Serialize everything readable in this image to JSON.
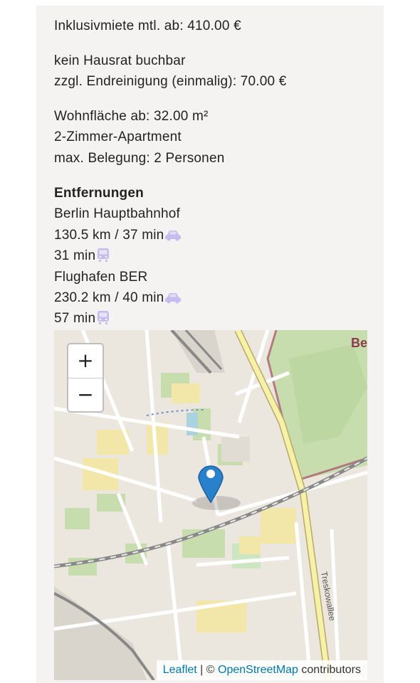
{
  "details": {
    "rent": "Inklusivmiete mtl. ab: 410.00 €",
    "household": "kein Hausrat buchbar",
    "cleaning": "zzgl. Endreinigung (einmalig): 70.00 €",
    "area": "Wohnfläche ab: 32.00 m²",
    "type": "2-Zimmer-Apartment",
    "occupancy": "max. Belegung: 2 Personen"
  },
  "distances": {
    "heading": "Entfernungen",
    "items": [
      {
        "place": "Berlin Hauptbahnhof",
        "car": "130.5 km / 37 min",
        "transit": "31 min"
      },
      {
        "place": "Flughafen BER",
        "car": "230.2 km / 40 min",
        "transit": "57 min"
      }
    ]
  },
  "map": {
    "zoom_in": "+",
    "zoom_out": "−",
    "attribution_leaflet": "Leaflet",
    "attribution_sep": " | © ",
    "attribution_osm": "OpenStreetMap",
    "attribution_tail": " contributors",
    "street_label": "Treskowallee",
    "corner_label": "Be"
  },
  "colors": {
    "icon": "#c5bdf0",
    "marker": "#2a81cb",
    "park": "#c8ddae",
    "road_major": "#f6f1a8",
    "boundary": "#a8566e"
  },
  "icons": {
    "car": "car-icon",
    "transit": "tram-icon",
    "marker": "map-marker-icon"
  }
}
